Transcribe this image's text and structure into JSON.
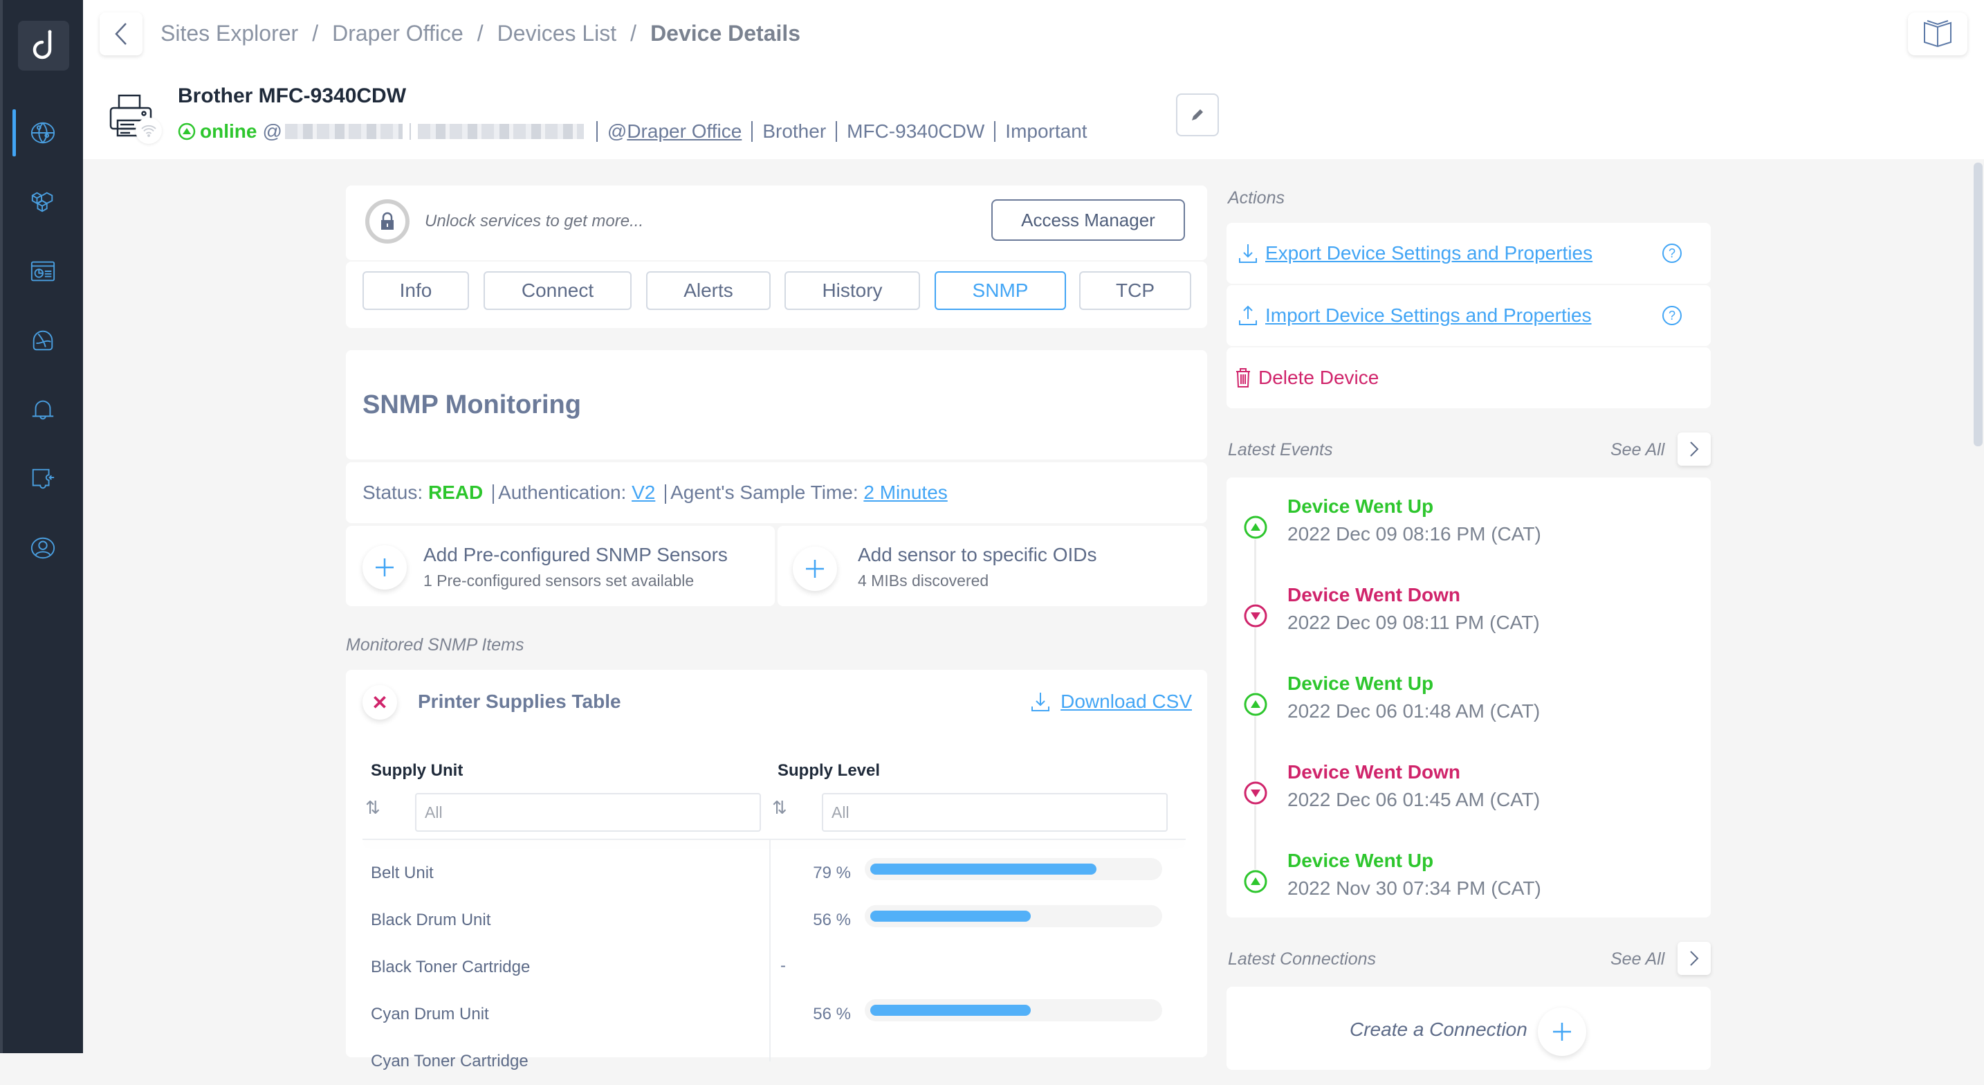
{
  "sidebar": {
    "logo": "d-logo",
    "items": [
      {
        "name": "sites-explorer",
        "icon": "globe-network-icon",
        "active": true
      },
      {
        "name": "integrations",
        "icon": "cubes-icon",
        "active": false
      },
      {
        "name": "dashboards",
        "icon": "dashboard-window-icon",
        "active": false
      },
      {
        "name": "monitoring",
        "icon": "gauge-icon",
        "active": false
      },
      {
        "name": "alerts",
        "icon": "bell-icon",
        "active": false
      },
      {
        "name": "connections",
        "icon": "remote-access-icon",
        "active": false
      },
      {
        "name": "account",
        "icon": "user-circle-icon",
        "active": false
      }
    ]
  },
  "header": {
    "breadcrumb": [
      "Sites Explorer",
      "Draper Office",
      "Devices List",
      "Device Details"
    ],
    "separator": "/",
    "device": {
      "name": "Brother MFC-9340CDW",
      "status": "online",
      "at": "@",
      "site": "Draper Office",
      "site_prefix": "@",
      "vendor": "Brother",
      "model": "MFC-9340CDW",
      "importance": "Important"
    }
  },
  "unlock": {
    "text": "Unlock services to get more...",
    "button": "Access Manager"
  },
  "tabs": [
    {
      "label": "Info",
      "active": false
    },
    {
      "label": "Connect",
      "active": false
    },
    {
      "label": "Alerts",
      "active": false
    },
    {
      "label": "History",
      "active": false
    },
    {
      "label": "SNMP",
      "active": true
    },
    {
      "label": "TCP",
      "active": false
    }
  ],
  "snmp": {
    "title": "SNMP Monitoring",
    "status_label": "Status: ",
    "status_value": "READ",
    "auth_label": "Authentication: ",
    "auth_value": "V2",
    "sample_label": "Agent's Sample Time: ",
    "sample_value": "2 Minutes",
    "sensors": [
      {
        "title": "Add Pre-configured SNMP Sensors",
        "subtitle": "1 Pre-configured sensors set available"
      },
      {
        "title": "Add sensor to specific OIDs",
        "subtitle": "4 MIBs discovered"
      }
    ],
    "monitored_label": "Monitored SNMP Items",
    "table": {
      "title": "Printer Supplies Table",
      "download": "Download CSV",
      "columns": [
        "Supply Unit",
        "Supply Level"
      ],
      "filter_placeholder": "All",
      "rows": [
        {
          "unit": "Belt Unit",
          "level": 79,
          "level_text": "79 %"
        },
        {
          "unit": "Black Drum Unit",
          "level": 56,
          "level_text": "56 %"
        },
        {
          "unit": "Black Toner Cartridge",
          "level": null,
          "level_text": "-"
        },
        {
          "unit": "Cyan Drum Unit",
          "level": 56,
          "level_text": "56 %"
        },
        {
          "unit": "Cyan Toner Cartridge",
          "level": null,
          "level_text": ""
        }
      ]
    }
  },
  "actions": {
    "label": "Actions",
    "export": "Export Device Settings and Properties",
    "import": "Import Device Settings and Properties",
    "delete": "Delete Device"
  },
  "events": {
    "label": "Latest Events",
    "see_all": "See All",
    "items": [
      {
        "type": "up",
        "title": "Device Went Up",
        "time": "2022 Dec 09 08:16 PM (CAT)"
      },
      {
        "type": "down",
        "title": "Device Went Down",
        "time": "2022 Dec 09 08:11 PM (CAT)"
      },
      {
        "type": "up",
        "title": "Device Went Up",
        "time": "2022 Dec 06 01:48 AM (CAT)"
      },
      {
        "type": "down",
        "title": "Device Went Down",
        "time": "2022 Dec 06 01:45 AM (CAT)"
      },
      {
        "type": "up",
        "title": "Device Went Up",
        "time": "2022 Nov 30 07:34 PM (CAT)"
      }
    ]
  },
  "connections": {
    "label": "Latest Connections",
    "see_all": "See All",
    "create": "Create a Connection"
  },
  "colors": {
    "accent": "#42a5f5",
    "online": "#2dc62d",
    "danger": "#d0246b",
    "sidebar": "#232b38",
    "background": "#f5f5f5"
  }
}
